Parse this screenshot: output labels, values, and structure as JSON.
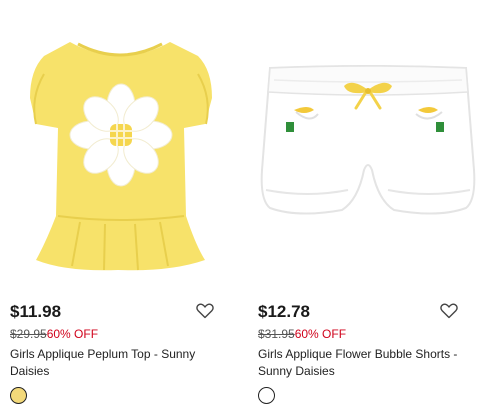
{
  "products": [
    {
      "price": "$11.98",
      "original_price": "$29.95",
      "discount": "60% OFF",
      "title": "Girls Applique Peplum Top - Sunny Daisies",
      "swatch_color": "#f3d97a",
      "image": "yellow-peplum-top-with-daisy-applique",
      "favorite_icon": "heart-outline-icon"
    },
    {
      "price": "$12.78",
      "original_price": "$31.95",
      "discount": "60% OFF",
      "title": "Girls Applique Flower Bubble Shorts - Sunny Daisies",
      "swatch_color": "#ffffff",
      "image": "white-bubble-shorts-with-yellow-bow",
      "favorite_icon": "heart-outline-icon"
    }
  ],
  "colors": {
    "sale_red": "#d0021b",
    "shirt_yellow": "#f7e26a",
    "text_dark": "#1a1a1a"
  }
}
